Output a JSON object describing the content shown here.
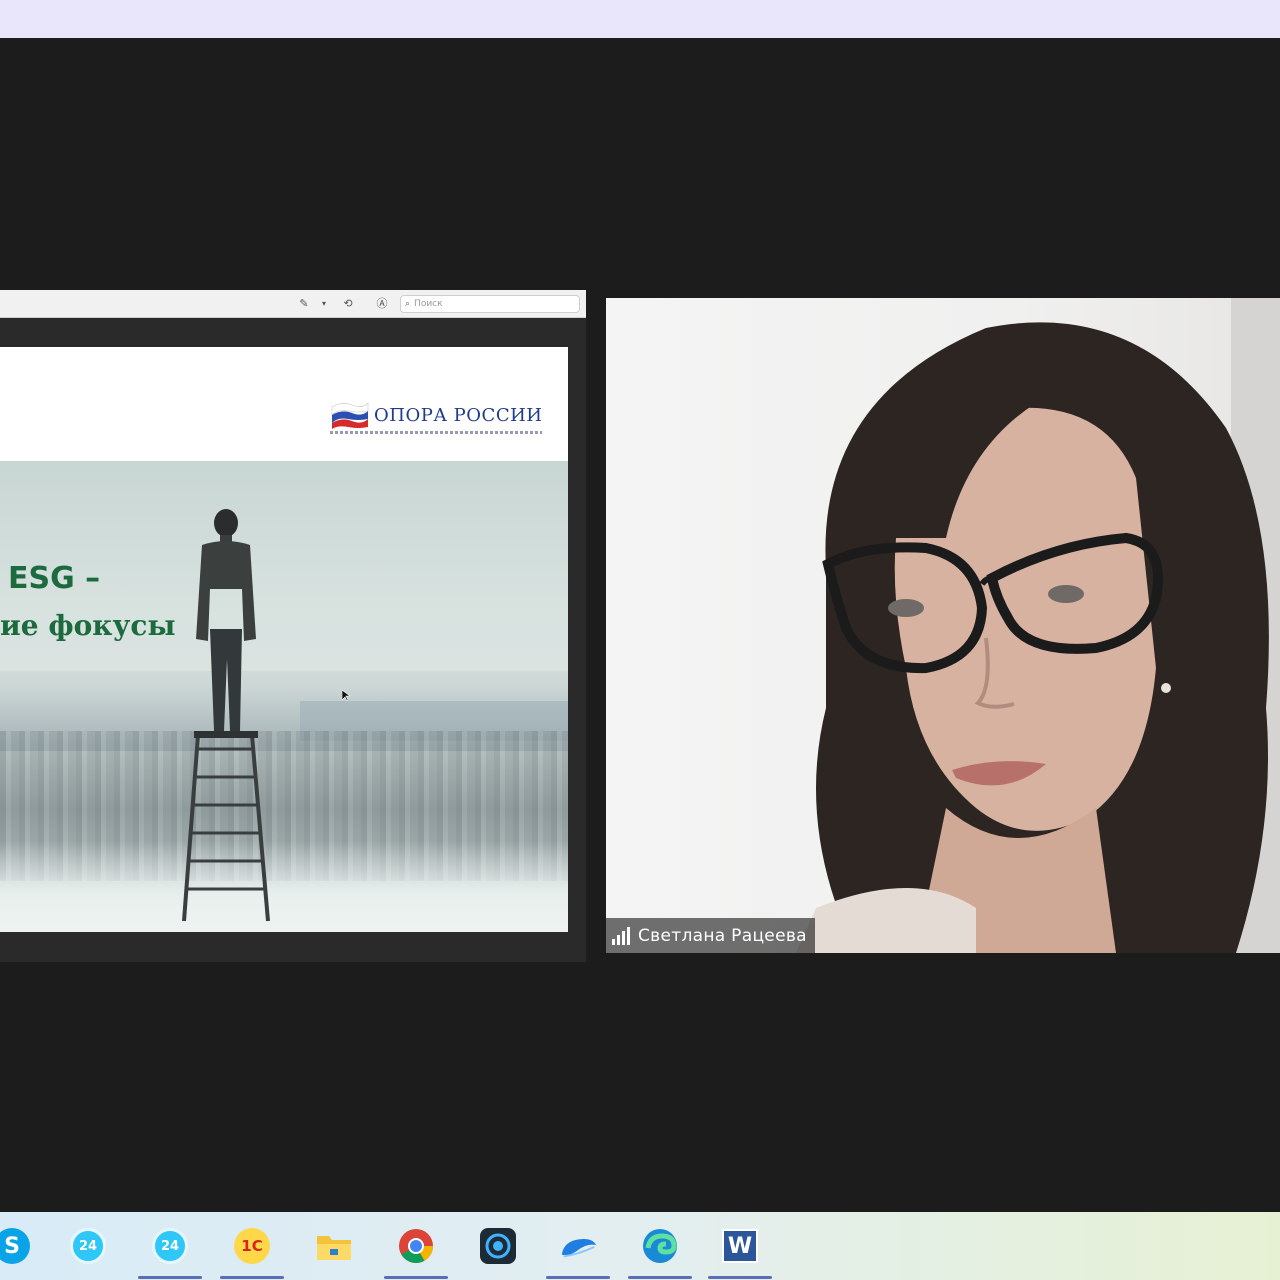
{
  "share": {
    "search_placeholder": "Поиск",
    "slide": {
      "logo_text": "ОПОРА РОССИИ",
      "title_line1": "ESG –",
      "title_line2": "ие фокусы"
    }
  },
  "participant": {
    "name": "Светлана Рацеева"
  },
  "taskbar": {
    "apps": [
      {
        "name": "skype-icon",
        "glyph": "S"
      },
      {
        "name": "bitrix24-icon",
        "glyph": "24"
      },
      {
        "name": "bitrix24-icon-2",
        "glyph": "24"
      },
      {
        "name": "1c-icon",
        "glyph": "1С"
      },
      {
        "name": "file-explorer-icon",
        "glyph": ""
      },
      {
        "name": "chrome-icon",
        "glyph": ""
      },
      {
        "name": "camera-app-icon",
        "glyph": ""
      },
      {
        "name": "cloud-app-icon",
        "glyph": ""
      },
      {
        "name": "edge-icon",
        "glyph": ""
      },
      {
        "name": "word-icon",
        "glyph": "W"
      }
    ]
  },
  "colors": {
    "accent_green": "#1c6b3f",
    "logo_blue": "#1f3b8f",
    "top_bar": "#e9e6fb",
    "stage_bg": "#1c1c1c"
  }
}
